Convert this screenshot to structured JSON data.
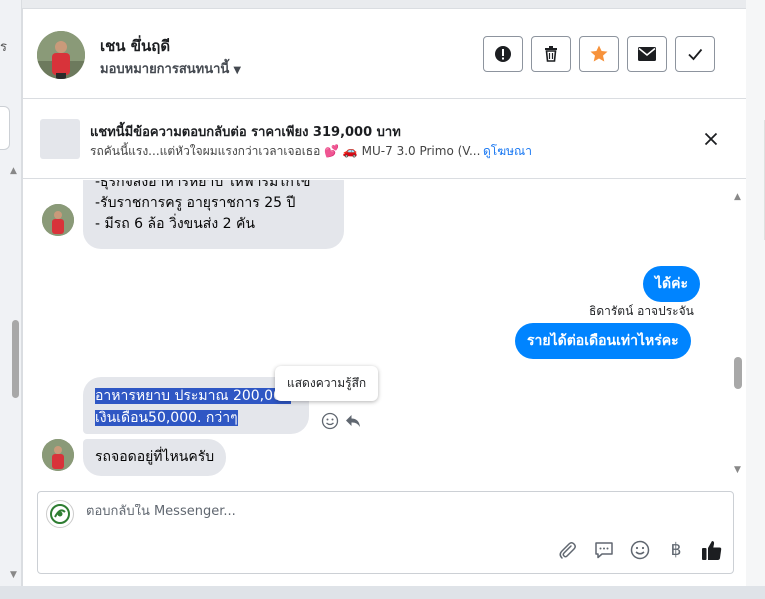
{
  "left_sidebar": {
    "cut_letter": "ร"
  },
  "header": {
    "contact_name": "เชน ขึ่นฤดี",
    "assign_label": "มอบหมายการสนทนานี้"
  },
  "ad": {
    "title": "แชทนี้มีข้อความตอบกลับต่อ ราคาเพียง 319,000 บาท",
    "subtitle": "รถคันนี้แรง...แต่หัวใจผมแรงกว่าเวลาเจอเธอ 💕 🚗 MU-7 3.0 Primo (V...",
    "link_label": "ดูโฆษณา"
  },
  "messages": {
    "first": {
      "line1": "-ธุรกิจส่งอาหารหยาบ ให้ฟาร์มไก่ไข่",
      "line2": "-รับราชการครู  อายุราชการ 25 ปี",
      "line3": "- มีรถ 6 ล้อ วิ่งขนส่ง 2 คัน"
    },
    "reply1": "ได้ค่ะ",
    "sender": "ธิดารัตน์ อาจประจัน",
    "reply2": "รายได้ต่อเดือนเท่าไหร่คะ",
    "income": {
      "line1": "อาหารหยาบ ประมาณ 200,000",
      "line2": "เงินเดือน50,000. กว่าๆ"
    },
    "tooltip": "แสดงความรู้สึก",
    "last": "รถจอดอยู่ที่ไหนครับ"
  },
  "composer": {
    "placeholder": "ตอบกลับใน Messenger..."
  },
  "colors": {
    "accent": "#0084ff",
    "selection": "#2f57c4",
    "star": "#f7923b"
  },
  "icons": [
    "alert-icon",
    "trash-icon",
    "star-icon",
    "mail-icon",
    "check-icon",
    "close-icon",
    "smiley-icon",
    "reply-icon",
    "paperclip-icon",
    "chat-bubble-icon",
    "emoji-icon",
    "baht-icon",
    "thumbs-up-icon"
  ]
}
